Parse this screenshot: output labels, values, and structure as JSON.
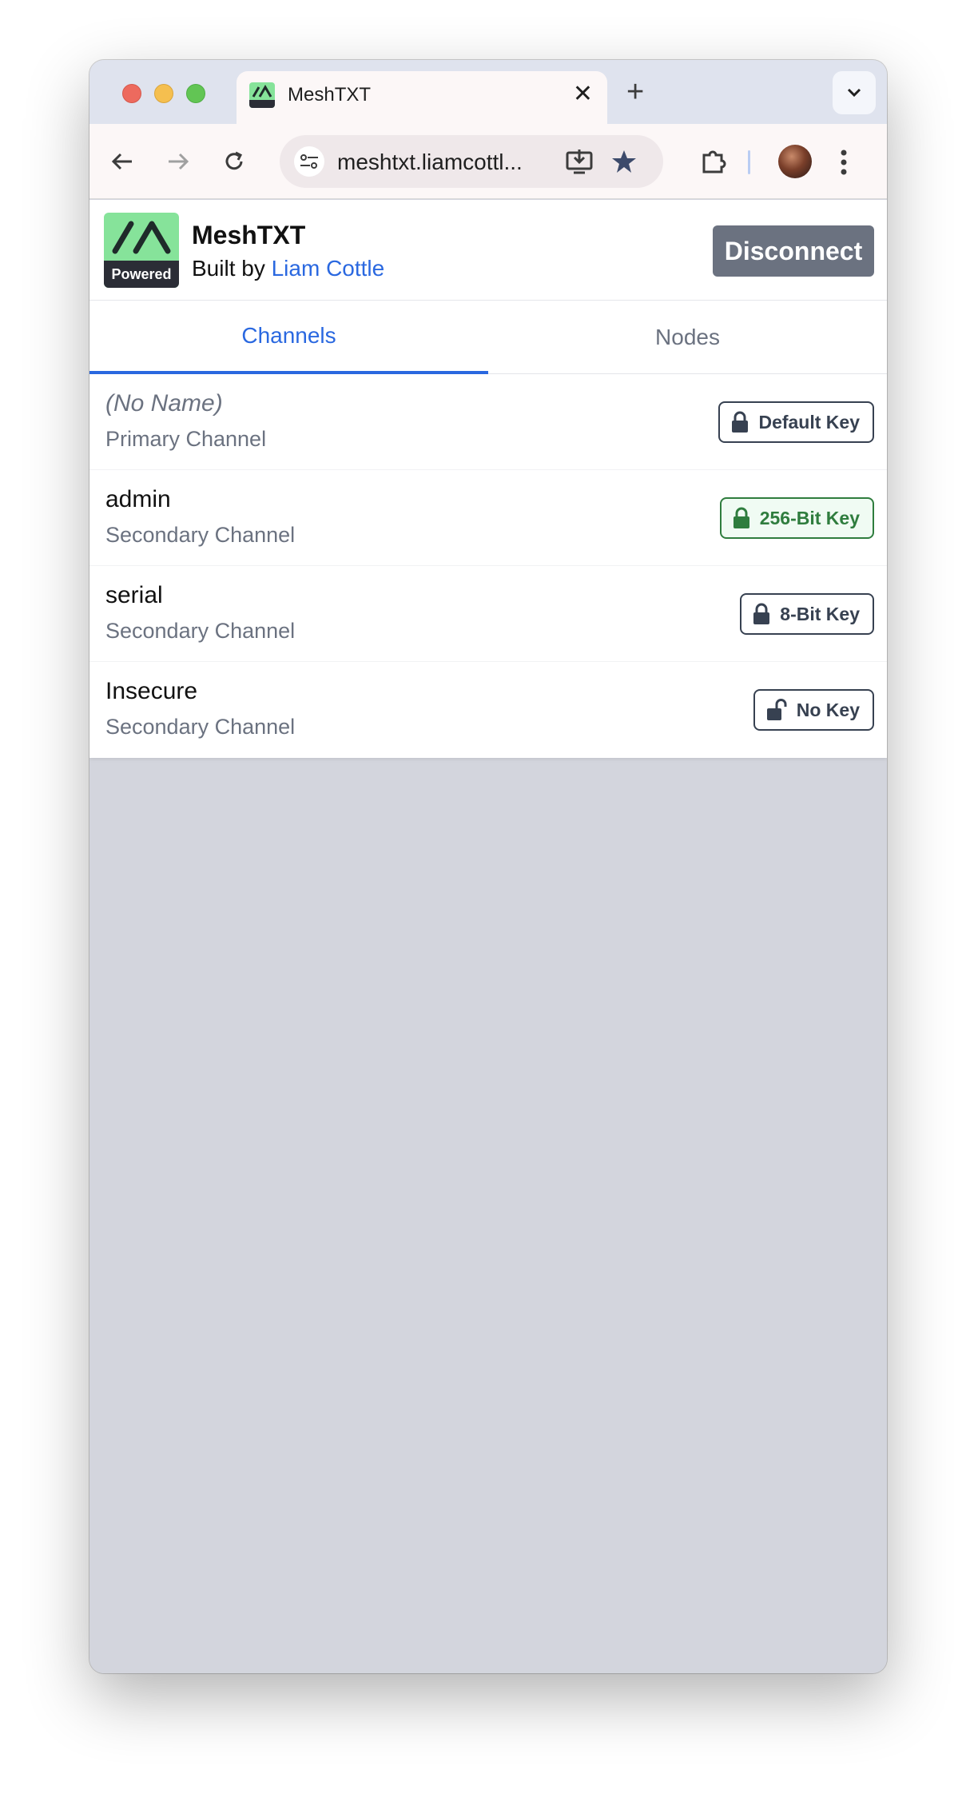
{
  "browser": {
    "tab_title": "MeshTXT",
    "url": "meshtxt.liamcottl..."
  },
  "app": {
    "title": "MeshTXT",
    "built_by_prefix": "Built by ",
    "author": "Liam Cottle",
    "logo_badge": "Powered",
    "disconnect_label": "Disconnect"
  },
  "tabs": [
    {
      "label": "Channels",
      "active": true
    },
    {
      "label": "Nodes",
      "active": false
    }
  ],
  "channels": [
    {
      "name": "(No Name)",
      "type": "Primary Channel",
      "key": "Default Key",
      "lock": "locked",
      "color": "#374151"
    },
    {
      "name": "admin",
      "type": "Secondary Channel",
      "key": "256-Bit Key",
      "lock": "locked",
      "color": "#2f7d3e"
    },
    {
      "name": "serial",
      "type": "Secondary Channel",
      "key": "8-Bit Key",
      "lock": "locked",
      "color": "#374151"
    },
    {
      "name": "Insecure",
      "type": "Secondary Channel",
      "key": "No Key",
      "lock": "unlocked",
      "color": "#374151"
    }
  ]
}
